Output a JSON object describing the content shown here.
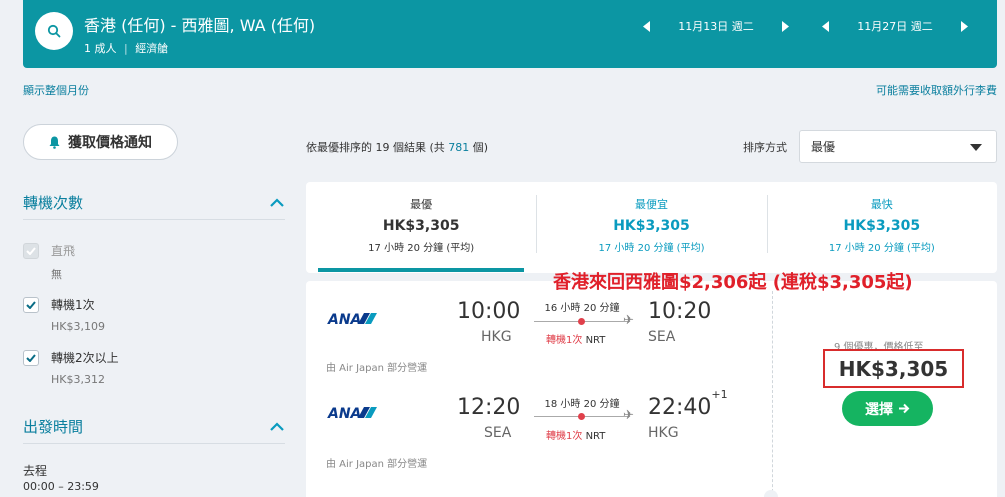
{
  "colors": {
    "teal": "#0c96a3",
    "link": "#0a7f9e",
    "accent_blue": "#0a9bbf",
    "green": "#15b461",
    "red": "#e0202a"
  },
  "search": {
    "route": "香港 (任何) - 西雅圖, WA (任何)",
    "travellers": "1 成人",
    "cabin": "經濟艙",
    "depart_date": "11月13日 週二",
    "return_date": "11月27日 週二",
    "icon": "search-icon"
  },
  "links": {
    "month_view": "顯示整個月份",
    "bag_fees": "可能需要收取額外行李費"
  },
  "sidebar": {
    "price_alert": "獲取價格通知",
    "stops": {
      "title": "轉機次數",
      "items": [
        {
          "label": "直飛",
          "price": "無",
          "checked": true,
          "disabled": true
        },
        {
          "label": "轉機1次",
          "price": "HK$3,109",
          "checked": true,
          "disabled": false
        },
        {
          "label": "轉機2次以上",
          "price": "HK$3,312",
          "checked": true,
          "disabled": false
        }
      ]
    },
    "departure_time": {
      "title": "出發時間",
      "outbound_label": "去程",
      "outbound_range": "00:00 – 23:59"
    }
  },
  "results": {
    "prefix": "依最優排序的",
    "count": "19",
    "middle": "個結果 (共",
    "total": "781",
    "suffix": "個)",
    "sort_label": "排序方式",
    "sort_value": "最優"
  },
  "tabs": [
    {
      "title": "最優",
      "price": "HK$3,305",
      "duration": "17 小時 20 分鐘 (平均)"
    },
    {
      "title": "最便宜",
      "price": "HK$3,305",
      "duration": "17 小時 20 分鐘 (平均)"
    },
    {
      "title": "最快",
      "price": "HK$3,305",
      "duration": "17 小時 20 分鐘 (平均)"
    }
  ],
  "promo": "香港來回西雅圖$2,306起 (連稅$3,305起)",
  "card": {
    "legs": [
      {
        "airline": "ANA",
        "operated_by": "由 Air Japan 部分營運",
        "dep_time": "10:00",
        "dep_apt": "HKG",
        "duration": "16 小時 20 分鐘",
        "stops": "轉機1次",
        "via": "NRT",
        "arr_time": "10:20",
        "arr_day": "",
        "arr_apt": "SEA"
      },
      {
        "airline": "ANA",
        "operated_by": "由 Air Japan 部分營運",
        "dep_time": "12:20",
        "dep_apt": "SEA",
        "duration": "18 小時 20 分鐘",
        "stops": "轉機1次",
        "via": "NRT",
        "arr_time": "22:40",
        "arr_day": "+1",
        "arr_apt": "HKG"
      }
    ],
    "deals": "9 個優惠，價格低至",
    "price": "HK$3,305",
    "select_label": "選擇"
  }
}
